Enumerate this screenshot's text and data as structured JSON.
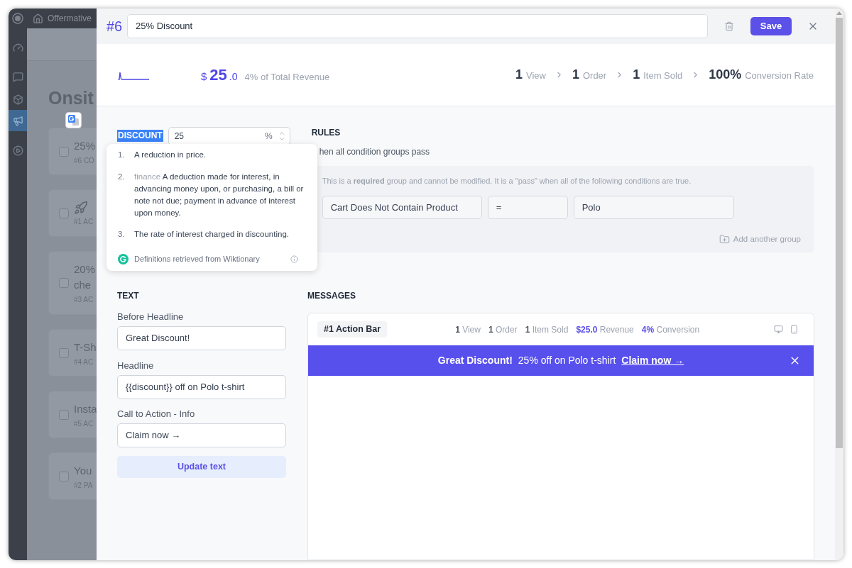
{
  "admin_bar": {
    "site": "Offermative"
  },
  "admin_menu": [
    {
      "selected": false
    },
    {
      "selected": false
    },
    {
      "selected": false
    },
    {
      "selected": true
    },
    {
      "selected": false
    }
  ],
  "list_page": {
    "title": "Onsit",
    "cards": [
      {
        "kind": "text",
        "title": "25%",
        "meta": "#6 CO",
        "checked": false
      },
      {
        "kind": "icon",
        "meta": "#1 AC",
        "checked": false
      },
      {
        "kind": "text",
        "title": "20% che",
        "meta": "#3 AC",
        "checked": false
      },
      {
        "kind": "text",
        "title": "T-Sh",
        "meta": "#4 AC",
        "checked": false
      },
      {
        "kind": "text",
        "title": "Insta",
        "meta": "#5 AC",
        "checked": false
      },
      {
        "kind": "text",
        "title": "You",
        "meta": "#2 PA",
        "checked": false
      }
    ]
  },
  "editor": {
    "number": "#6",
    "title": "25% Discount",
    "save": "Save",
    "summary": {
      "currency": "$",
      "amount": "25",
      "decimals": ".0",
      "share": "4% of Total Revenue",
      "funnel": [
        {
          "value": "1",
          "label": "View"
        },
        {
          "value": "1",
          "label": "Order"
        },
        {
          "value": "1",
          "label": "Item Sold"
        },
        {
          "value": "100%",
          "label": "Conversion Rate"
        }
      ]
    },
    "discount": {
      "label": "DISCOUNT",
      "selected": true,
      "value": "25",
      "unit": "%"
    },
    "definition_popup": {
      "definitions": [
        {
          "number": "1.",
          "text": "A reduction in price."
        },
        {
          "number": "2.",
          "tag": "finance",
          "text": "A deduction made for interest, in advancing money upon, or purchasing, a bill or note not due; payment in advance of interest upon money."
        },
        {
          "number": "3.",
          "text": "The rate of interest charged in discounting."
        }
      ],
      "source": "Definitions retrieved from Wiktionary"
    },
    "rules": {
      "title": "RULES",
      "subtitle": "hen all condition groups pass",
      "group": {
        "note": "This is a **required** group and cannot be modified. It is a \"pass\" when all of the following conditions are true.",
        "conditions": [
          {
            "field": "Cart Does Not Contain Product",
            "operator": "=",
            "value": "Polo"
          }
        ]
      },
      "add_group": "Add another group"
    },
    "text": {
      "title": "TEXT",
      "fields": [
        {
          "label": "Before Headline",
          "value": "Great Discount!"
        },
        {
          "label": "Headline",
          "value": "{{discount}} off on Polo t-shirt"
        },
        {
          "label": "Call to Action - Info",
          "value": "Claim now →"
        }
      ],
      "button": "Update text"
    },
    "messages": {
      "title": "MESSAGES",
      "items": [
        {
          "name": "#1 Action Bar",
          "stats": [
            {
              "text": "**1** View",
              "highlight": false
            },
            {
              "text": "**1** Order",
              "highlight": false
            },
            {
              "text": "**1** Item Sold",
              "highlight": false
            },
            {
              "text": "**$25.0** Revenue",
              "highlight": true
            },
            {
              "text": "**4%** Conversion",
              "highlight": true
            }
          ],
          "preview": {
            "lead": "Great Discount!",
            "headline": "25% off on Polo t-shirt",
            "cta": "Claim now →"
          }
        }
      ]
    }
  }
}
